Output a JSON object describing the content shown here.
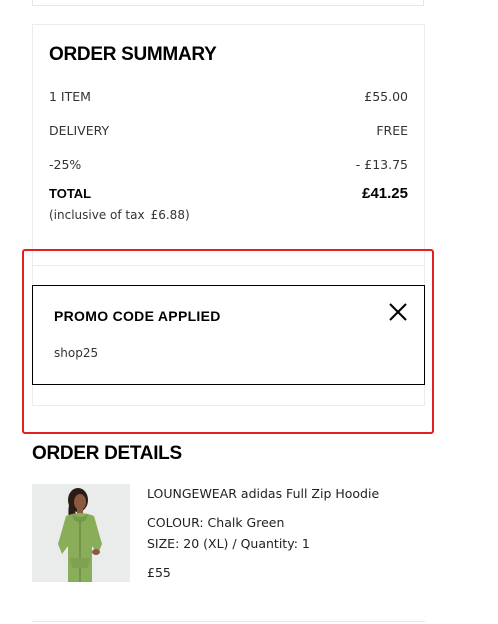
{
  "summary": {
    "title": "ORDER SUMMARY",
    "items_label": "1 ITEM",
    "items_value": "£55.00",
    "delivery_label": "DELIVERY",
    "delivery_value": "FREE",
    "discount_label": "-25%",
    "discount_value": "- £13.75",
    "total_label": "TOTAL",
    "total_value": "£41.25",
    "tax_prefix": "(inclusive of tax",
    "tax_value": "£6.88)"
  },
  "promo": {
    "title": "PROMO CODE APPLIED",
    "code": "shop25",
    "close_icon": "close-icon"
  },
  "details": {
    "title": "ORDER DETAILS",
    "product": {
      "name": "LOUNGEWEAR adidas Full Zip Hoodie",
      "colour": "COLOUR: Chalk Green",
      "size_quantity": "SIZE: 20 (XL) / Quantity: 1",
      "price": "£55",
      "image_icon": "hoodie-product-image"
    }
  },
  "colors": {
    "highlight": "#e0211d",
    "product_green": "#8aad5a",
    "product_bg": "#e9ecea"
  }
}
